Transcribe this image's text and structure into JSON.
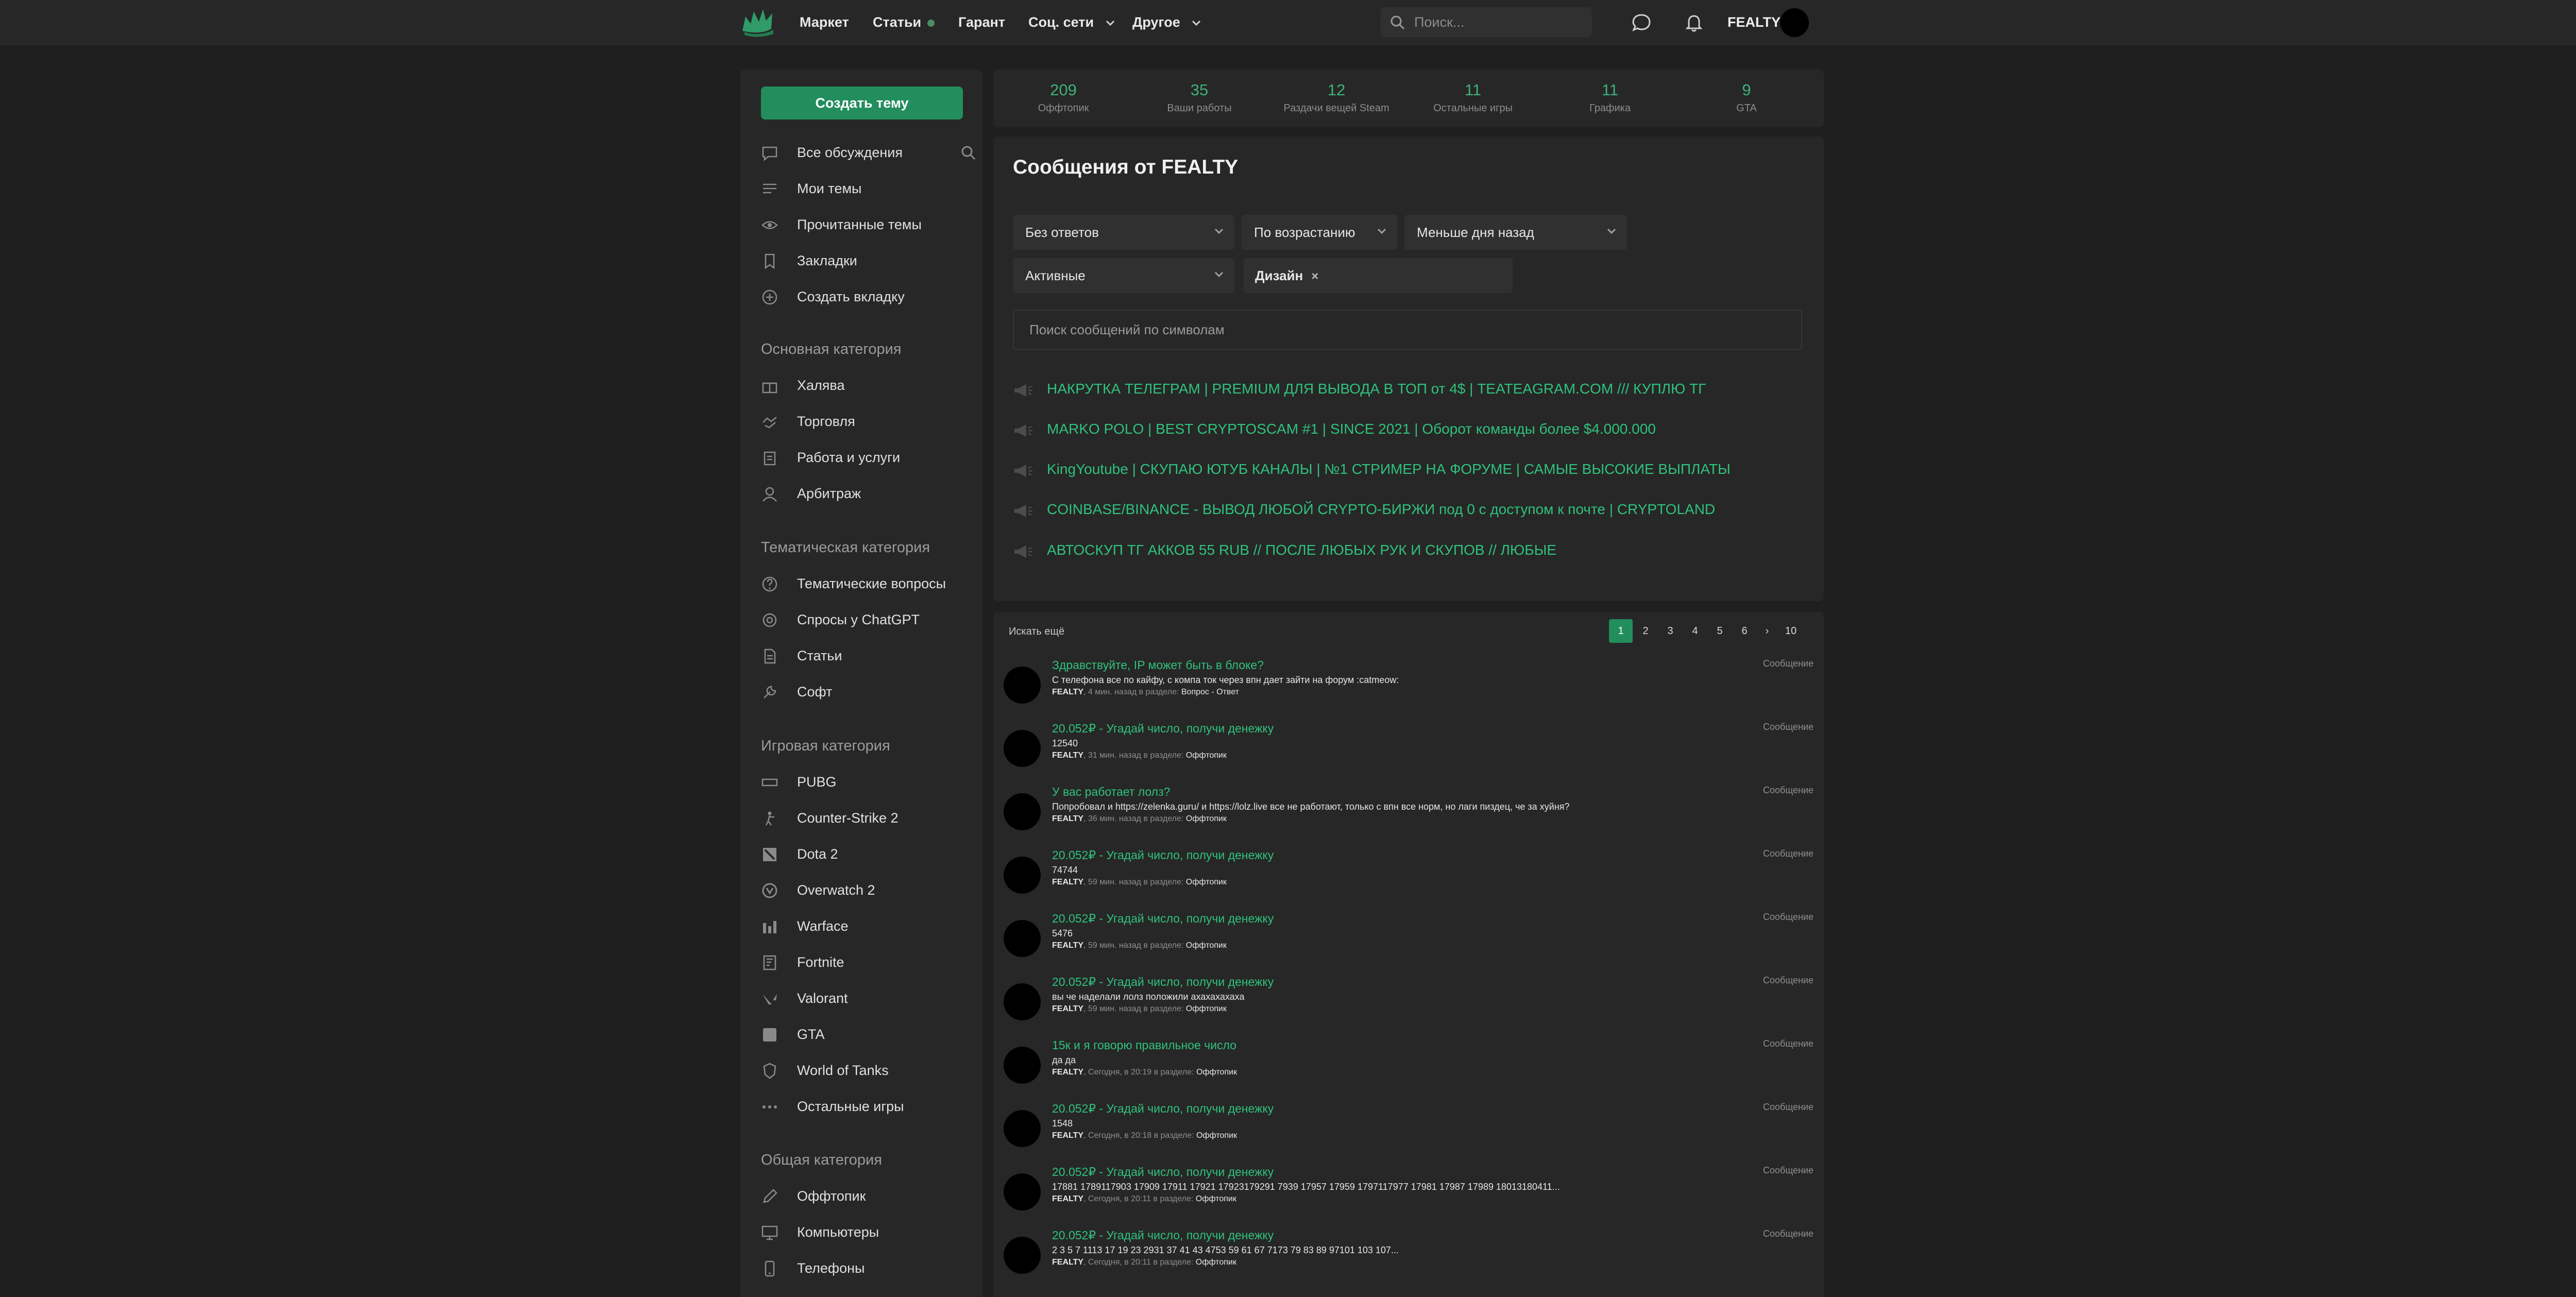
{
  "colors": {
    "accent": "#228e5d",
    "link_green": "#2fc27c",
    "bg": "#1f1f1f",
    "panel": "#272727"
  },
  "nav": {
    "items": [
      {
        "label": "Маркет"
      },
      {
        "label": "Статьи"
      },
      {
        "label": "Гарант"
      },
      {
        "label": "Соц. сети"
      },
      {
        "label": "Другое"
      }
    ],
    "search_placeholder": "Поиск...",
    "username": "FEALTY"
  },
  "sidebar": {
    "create_button": "Создать тему",
    "items": [
      {
        "label": "Все обсуждения",
        "icon": "chat-icon"
      },
      {
        "label": "Мои темы",
        "icon": "list-icon"
      },
      {
        "label": "Прочитанные темы",
        "icon": "eye-icon"
      },
      {
        "label": "Закладки",
        "icon": "bookmark-icon"
      },
      {
        "label": "Создать вкладку",
        "icon": "plus-circle-icon"
      }
    ],
    "sections": [
      {
        "title": "Основная категория",
        "items": [
          {
            "label": "Халява",
            "icon": "gift-icon"
          },
          {
            "label": "Торговля",
            "icon": "handshake-icon"
          },
          {
            "label": "Работа и услуги",
            "icon": "clipboard-icon"
          },
          {
            "label": "Арбитраж",
            "icon": "user-icon"
          }
        ]
      },
      {
        "title": "Тематическая категория",
        "items": [
          {
            "label": "Тематические вопросы",
            "icon": "question-icon"
          },
          {
            "label": "Спросы у ChatGPT",
            "icon": "openai-icon"
          },
          {
            "label": "Статьи",
            "icon": "document-icon"
          },
          {
            "label": "Софт",
            "icon": "wrench-icon"
          }
        ]
      },
      {
        "title": "Игровая категория",
        "items": [
          {
            "label": "PUBG",
            "icon": "pubg-icon"
          },
          {
            "label": "Counter-Strike 2",
            "icon": "cs2-icon"
          },
          {
            "label": "Dota 2",
            "icon": "dota-icon"
          },
          {
            "label": "Overwatch 2",
            "icon": "overwatch-icon"
          },
          {
            "label": "Warface",
            "icon": "warface-icon"
          },
          {
            "label": "Fortnite",
            "icon": "fortnite-icon"
          },
          {
            "label": "Valorant",
            "icon": "valorant-icon"
          },
          {
            "label": "GTA",
            "icon": "gta-icon"
          },
          {
            "label": "World of Tanks",
            "icon": "tank-icon"
          },
          {
            "label": "Остальные игры",
            "icon": "dots-icon"
          }
        ]
      },
      {
        "title": "Общая категория",
        "items": [
          {
            "label": "Оффтопик",
            "icon": "pencil-icon"
          },
          {
            "label": "Компьютеры",
            "icon": "monitor-icon"
          },
          {
            "label": "Телефоны",
            "icon": "phone-icon"
          }
        ]
      }
    ]
  },
  "stats": [
    {
      "num": "209",
      "label": "Оффтопик"
    },
    {
      "num": "35",
      "label": "Ваши работы"
    },
    {
      "num": "12",
      "label": "Раздачи вещей Steam"
    },
    {
      "num": "11",
      "label": "Остальные игры"
    },
    {
      "num": "11",
      "label": "Графика"
    },
    {
      "num": "9",
      "label": "GTA"
    }
  ],
  "messages": {
    "title": "Сообщения от FEALTY",
    "filters": {
      "replies": "Без ответов",
      "order": "По возрастанию",
      "period": "Меньше дня назад",
      "state": "Активные",
      "tag": "Дизайн",
      "tag_remove": "×"
    },
    "search_placeholder": "Поиск сообщений по символам",
    "promos": [
      "НАКРУТКА ТЕЛЕГРАМ | PREMIUM ДЛЯ ВЫВОДА В ТОП от 4$ | TEATEAGRAM.COM /// КУПЛЮ ТГ",
      "MARKO POLO | BEST CRYPTOSCAM #1 | SINCE 2021 | Оборот команды более $4.000.000",
      "KingYoutube | СКУПАЮ ЮТУБ КАНАЛЫ | №1 СТРИМЕР НА ФОРУМЕ | САМЫЕ ВЫСОКИЕ ВЫПЛАТЫ",
      "COINBASE/BINANCE - ВЫВОД ЛЮБОЙ CRYPTO-БИРЖИ под 0 с доступом к почте | CRYPTOLAND",
      "АВТОСКУП ТГ АККОВ 55 RUB // ПОСЛЕ ЛЮБЫХ РУК И СКУПОВ // ЛЮБЫЕ"
    ]
  },
  "results": {
    "search_more": "Искать ещё",
    "pages": [
      "1",
      "2",
      "3",
      "4",
      "5",
      "6",
      "›",
      "10"
    ],
    "rows": [
      {
        "title": "Здравствуйте, IP может быть в блоке?",
        "text": "С телефона все по кайфу, с компа ток через впн дает зайти на форум :catmeow:",
        "author": "FEALTY",
        "meta": ", 4 мин. назад в разделе: ",
        "section": "Вопрос - Ответ",
        "type": "Сообщение"
      },
      {
        "title": "20.052₽ - Угадай число, получи денежку",
        "text": "12540",
        "author": "FEALTY",
        "meta": ", 31 мин. назад в разделе: ",
        "section": "Оффтопик",
        "type": "Сообщение"
      },
      {
        "title": "У вас работает лолз?",
        "text": "Попробовал и https://zelenka.guru/ и https://lolz.live все не работают, только с впн все норм, но лаги пиздец, че за хуйня?",
        "author": "FEALTY",
        "meta": ", 36 мин. назад в разделе: ",
        "section": "Оффтопик",
        "type": "Сообщение"
      },
      {
        "title": "20.052₽ - Угадай число, получи денежку",
        "text": "74744",
        "author": "FEALTY",
        "meta": ", 59 мин. назад в разделе: ",
        "section": "Оффтопик",
        "type": "Сообщение"
      },
      {
        "title": "20.052₽ - Угадай число, получи денежку",
        "text": "5476",
        "author": "FEALTY",
        "meta": ", 59 мин. назад в разделе: ",
        "section": "Оффтопик",
        "type": "Сообщение"
      },
      {
        "title": "20.052₽ - Угадай число, получи денежку",
        "text": "вы че наделали лолз положили ахахахахаха",
        "author": "FEALTY",
        "meta": ", 59 мин. назад в разделе: ",
        "section": "Оффтопик",
        "type": "Сообщение"
      },
      {
        "title": "15к и я говорю правильное число",
        "text": "да да",
        "author": "FEALTY",
        "meta": ", Сегодня, в 20:19 в разделе: ",
        "section": "Оффтопик",
        "type": "Сообщение"
      },
      {
        "title": "20.052₽ - Угадай число, получи денежку",
        "text": "1548",
        "author": "FEALTY",
        "meta": ", Сегодня, в 20:18 в разделе: ",
        "section": "Оффтопик",
        "type": "Сообщение"
      },
      {
        "title": "20.052₽ - Угадай число, получи денежку",
        "text": "17881 1789117903 17909 17911 17921 17923179291 7939 17957 17959 1797117977 17981 17987 17989 18013180411...",
        "author": "FEALTY",
        "meta": ", Сегодня, в 20:11 в разделе: ",
        "section": "Оффтопик",
        "type": "Сообщение"
      },
      {
        "title": "20.052₽ - Угадай число, получи денежку",
        "text": "2 3 5 7 1113 17 19 23 2931 37 41 43 4753 59 61 67 7173 79 83 89 97101 103 107...",
        "author": "FEALTY",
        "meta": ", Сегодня, в 20:11 в разделе: ",
        "section": "Оффтопик",
        "type": "Сообщение"
      }
    ]
  }
}
